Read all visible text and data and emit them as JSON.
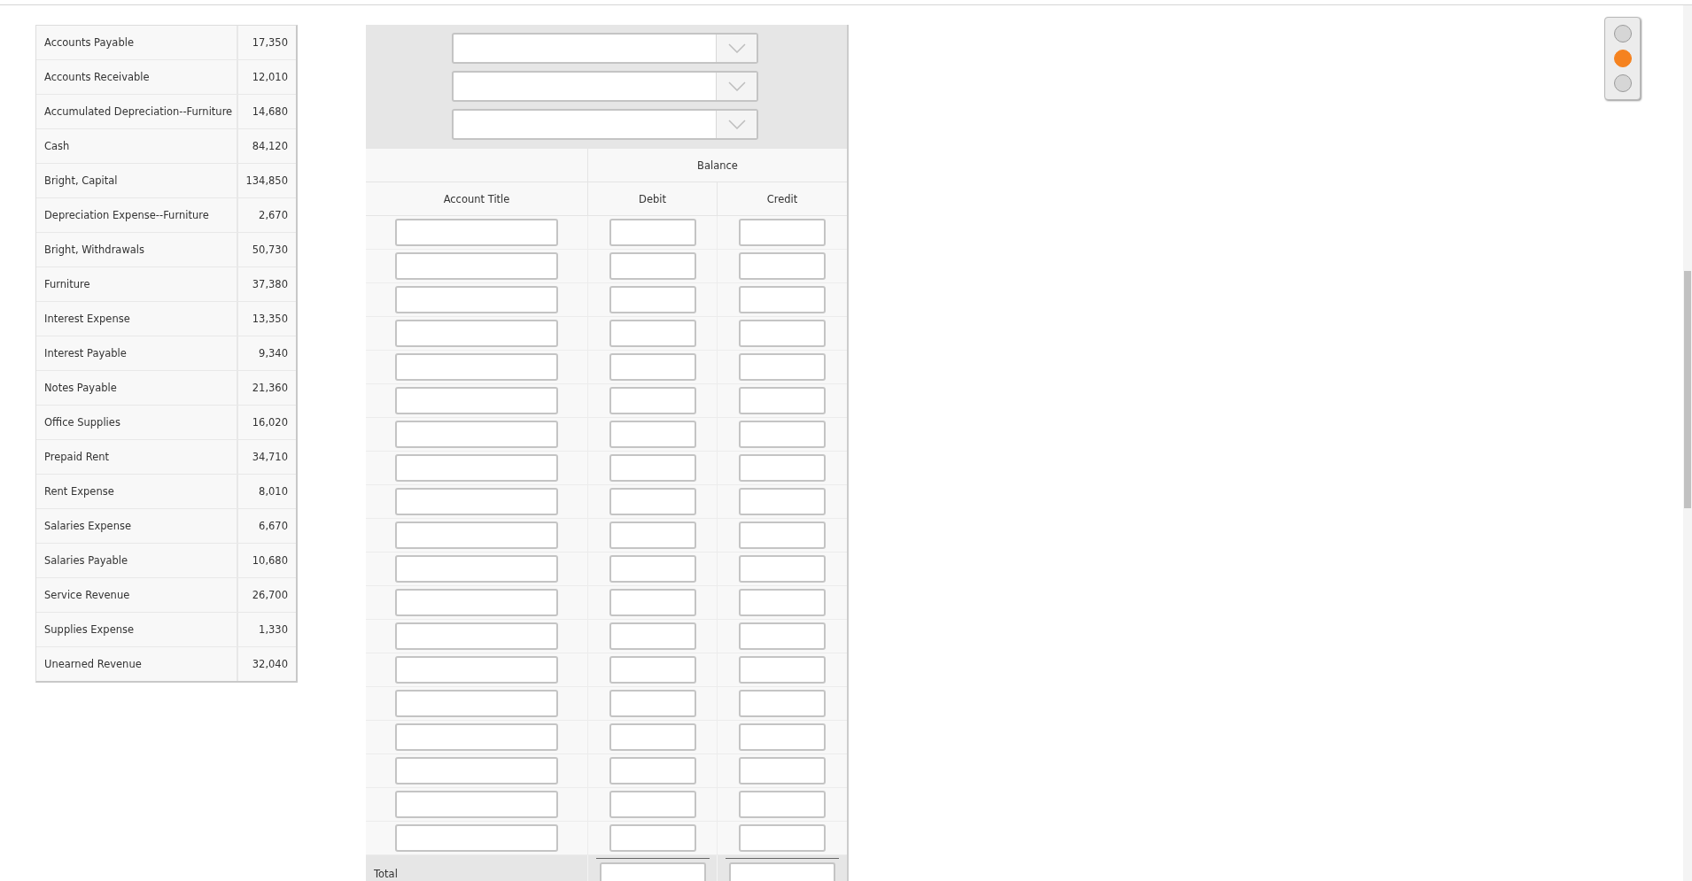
{
  "accounts": [
    {
      "title": "Accounts Payable",
      "amount": "17,350"
    },
    {
      "title": "Accounts Receivable",
      "amount": "12,010"
    },
    {
      "title": "Accumulated Depreciation--Furniture",
      "amount": "14,680"
    },
    {
      "title": "Cash",
      "amount": "84,120"
    },
    {
      "title": "Bright, Capital",
      "amount": "134,850"
    },
    {
      "title": "Depreciation Expense--Furniture",
      "amount": "2,670"
    },
    {
      "title": "Bright, Withdrawals",
      "amount": "50,730"
    },
    {
      "title": "Furniture",
      "amount": "37,380"
    },
    {
      "title": "Interest Expense",
      "amount": "13,350"
    },
    {
      "title": "Interest Payable",
      "amount": "9,340"
    },
    {
      "title": "Notes Payable",
      "amount": "21,360"
    },
    {
      "title": "Office Supplies",
      "amount": "16,020"
    },
    {
      "title": "Prepaid Rent",
      "amount": "34,710"
    },
    {
      "title": "Rent Expense",
      "amount": "8,010"
    },
    {
      "title": "Salaries Expense",
      "amount": "6,670"
    },
    {
      "title": "Salaries Payable",
      "amount": "10,680"
    },
    {
      "title": "Service Revenue",
      "amount": "26,700"
    },
    {
      "title": "Supplies Expense",
      "amount": "1,330"
    },
    {
      "title": "Unearned Revenue",
      "amount": "32,040"
    }
  ],
  "worksheet": {
    "dropdowns": [
      {
        "expanded": false
      },
      {
        "expanded": false
      },
      {
        "expanded": false
      }
    ],
    "group_header": "Balance",
    "columns": [
      "Account Title",
      "Debit",
      "Credit"
    ],
    "rows": [
      {
        "kind": "entry"
      },
      {
        "kind": "entry"
      },
      {
        "kind": "entry"
      },
      {
        "kind": "entry"
      },
      {
        "kind": "entry"
      },
      {
        "kind": "entry"
      },
      {
        "kind": "entry"
      },
      {
        "kind": "entry"
      },
      {
        "kind": "entry"
      },
      {
        "kind": "entry"
      },
      {
        "kind": "entry"
      },
      {
        "kind": "entry"
      },
      {
        "kind": "entry"
      },
      {
        "kind": "entry"
      },
      {
        "kind": "entry"
      },
      {
        "kind": "entry"
      },
      {
        "kind": "entry"
      },
      {
        "kind": "entry"
      },
      {
        "kind": "entry"
      }
    ],
    "total_label": "Total"
  },
  "steps": [
    {
      "selected": false
    },
    {
      "selected": true
    },
    {
      "selected": false
    }
  ]
}
